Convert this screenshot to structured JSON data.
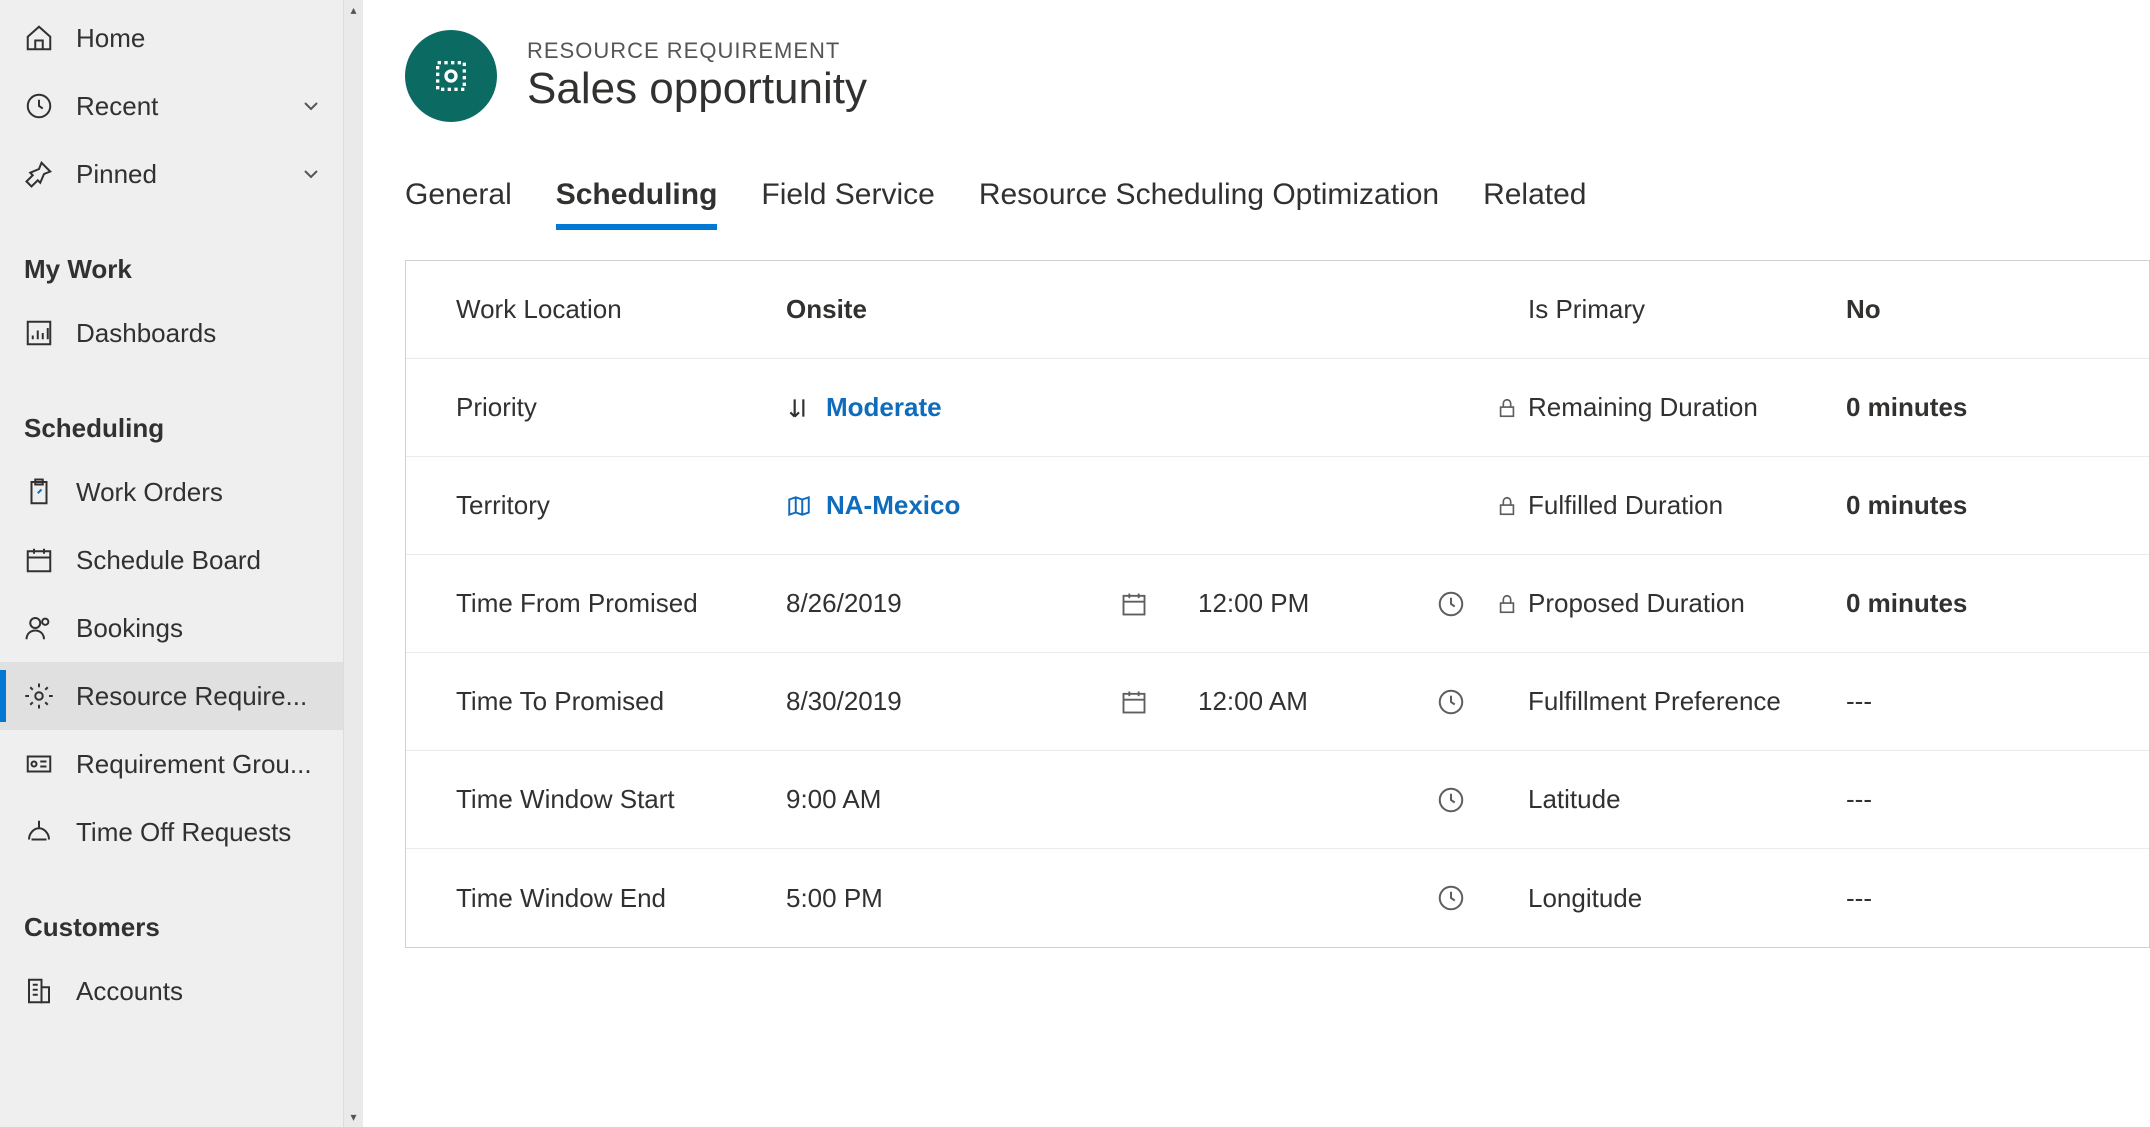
{
  "sidebar": {
    "topItems": [
      {
        "label": "Home",
        "icon": "home"
      },
      {
        "label": "Recent",
        "icon": "clock",
        "expandable": true
      },
      {
        "label": "Pinned",
        "icon": "pin",
        "expandable": true
      }
    ],
    "sections": [
      {
        "title": "My Work",
        "items": [
          {
            "label": "Dashboards",
            "icon": "dashboard"
          }
        ]
      },
      {
        "title": "Scheduling",
        "items": [
          {
            "label": "Work Orders",
            "icon": "clipboard"
          },
          {
            "label": "Schedule Board",
            "icon": "calendar"
          },
          {
            "label": "Bookings",
            "icon": "people"
          },
          {
            "label": "Resource Require...",
            "icon": "gear",
            "active": true
          },
          {
            "label": "Requirement Grou...",
            "icon": "card"
          },
          {
            "label": "Time Off Requests",
            "icon": "timeoff"
          }
        ]
      },
      {
        "title": "Customers",
        "items": [
          {
            "label": "Accounts",
            "icon": "building"
          }
        ]
      }
    ]
  },
  "header": {
    "entity": "RESOURCE REQUIREMENT",
    "title": "Sales opportunity"
  },
  "tabs": [
    {
      "label": "General"
    },
    {
      "label": "Scheduling",
      "active": true
    },
    {
      "label": "Field Service"
    },
    {
      "label": "Resource Scheduling Optimization"
    },
    {
      "label": "Related"
    }
  ],
  "fieldsLeft": {
    "workLocation": {
      "label": "Work Location",
      "value": "Onsite"
    },
    "priority": {
      "label": "Priority",
      "value": "Moderate"
    },
    "territory": {
      "label": "Territory",
      "value": "NA-Mexico"
    },
    "timeFrom": {
      "label": "Time From Promised",
      "date": "8/26/2019",
      "time": "12:00 PM"
    },
    "timeTo": {
      "label": "Time To Promised",
      "date": "8/30/2019",
      "time": "12:00 AM"
    },
    "winStart": {
      "label": "Time Window Start",
      "time": "9:00 AM"
    },
    "winEnd": {
      "label": "Time Window End",
      "time": "5:00 PM"
    }
  },
  "fieldsRight": {
    "isPrimary": {
      "label": "Is Primary",
      "value": "No"
    },
    "remaining": {
      "label": "Remaining Duration",
      "value": "0 minutes",
      "locked": true
    },
    "fulfilled": {
      "label": "Fulfilled Duration",
      "value": "0 minutes",
      "locked": true
    },
    "proposed": {
      "label": "Proposed Duration",
      "value": "0 minutes",
      "locked": true
    },
    "fulfillPref": {
      "label": "Fulfillment Preference",
      "value": "---"
    },
    "latitude": {
      "label": "Latitude",
      "value": "---"
    },
    "longitude": {
      "label": "Longitude",
      "value": "---"
    }
  }
}
